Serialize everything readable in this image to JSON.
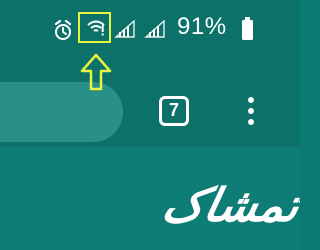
{
  "status_bar": {
    "battery_percent": "91%",
    "icons": {
      "alarm": "alarm-icon",
      "wifi": "wifi-warning-icon",
      "signal_1": "signal-icon",
      "signal_2": "signal-icon",
      "battery": "battery-icon"
    }
  },
  "browser": {
    "tab_count": "7",
    "menu_icon": "more-vert-icon"
  },
  "annotation": {
    "highlight_target": "wifi-status-icon",
    "arrow_icon": "up-arrow-icon"
  },
  "logo": {
    "text": "تمشاک"
  },
  "colors": {
    "background": "#0b7a73",
    "toolbar": "#0c7169",
    "pill": "#2a8f87",
    "highlight": "#e6f53f",
    "foreground": "#ffffff"
  }
}
